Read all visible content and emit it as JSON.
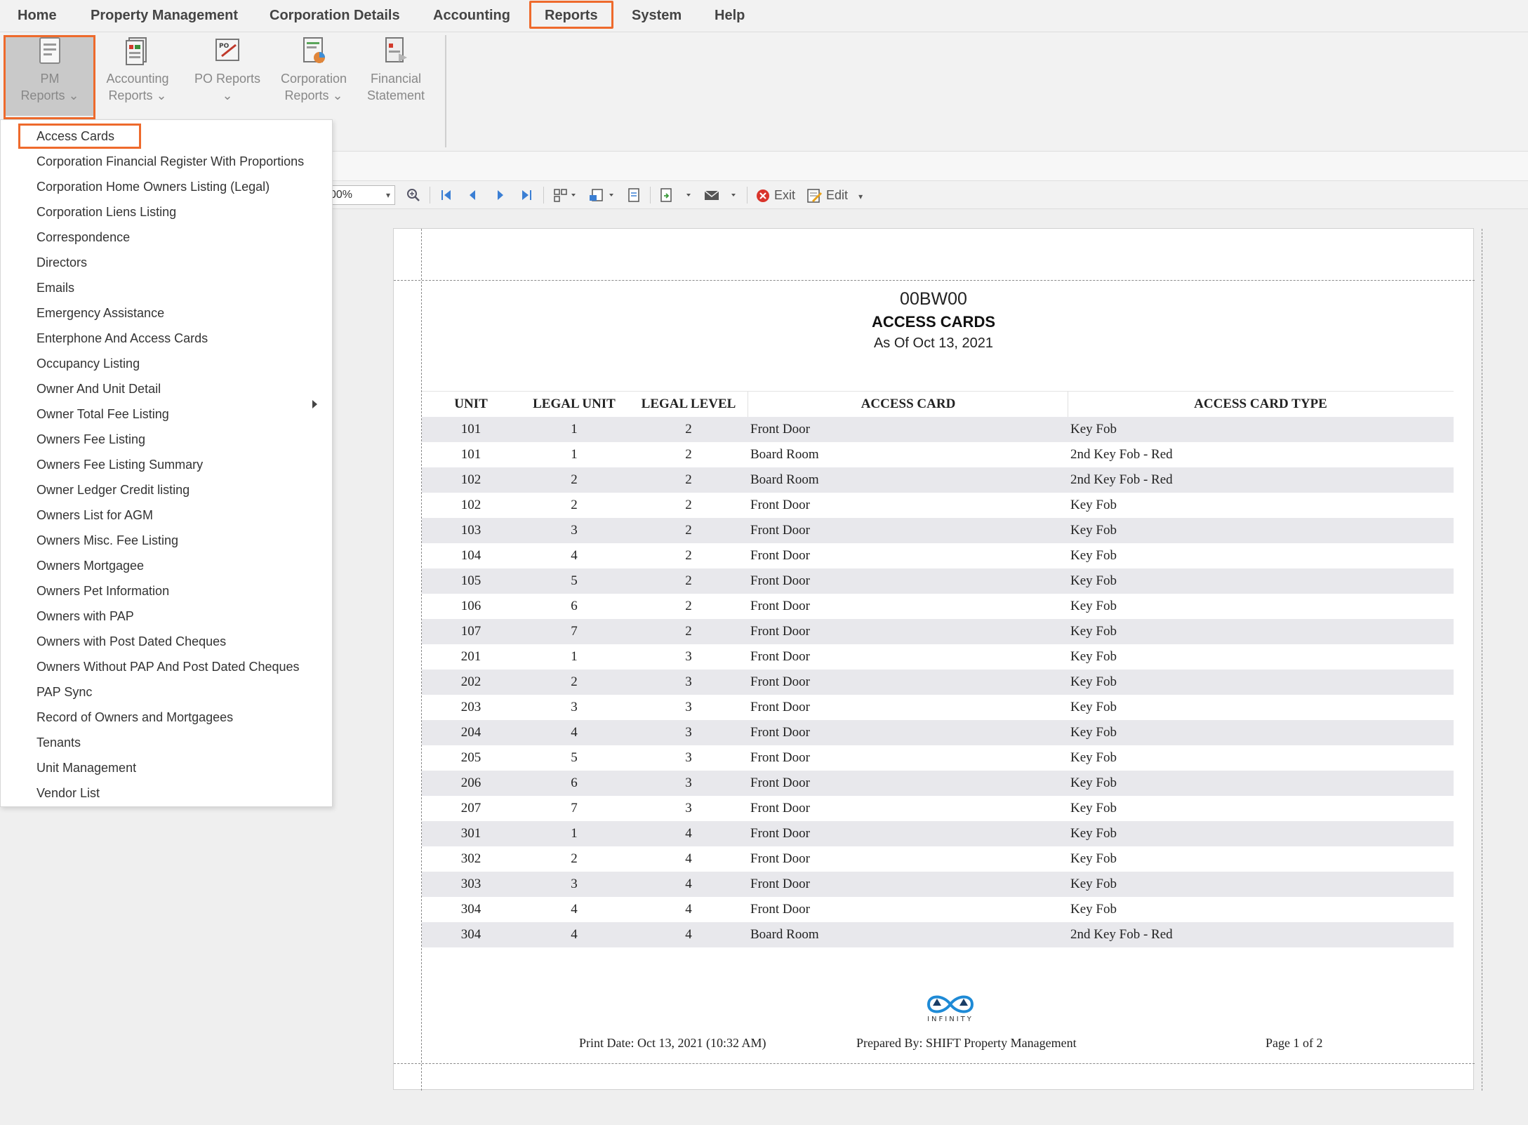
{
  "menubar": {
    "items": [
      "Home",
      "Property Management",
      "Corporation Details",
      "Accounting",
      "Reports",
      "System",
      "Help"
    ],
    "active": "Reports"
  },
  "ribbon": {
    "buttons": [
      {
        "line1": "PM",
        "line2": "Reports ⌄",
        "icon": "pm-reports-icon"
      },
      {
        "line1": "Accounting",
        "line2": "Reports ⌄",
        "icon": "accounting-reports-icon"
      },
      {
        "line1": "PO Reports",
        "line2": "⌄",
        "icon": "po-reports-icon"
      },
      {
        "line1": "Corporation",
        "line2": "Reports ⌄",
        "icon": "corporation-reports-icon"
      },
      {
        "line1": "Financial",
        "line2": "Statement",
        "icon": "financial-statement-icon"
      }
    ]
  },
  "toolbar": {
    "zoom": "00%",
    "exit_label": "Exit",
    "edit_label": "Edit"
  },
  "dropdown": {
    "items": [
      "Access Cards",
      "Corporation Financial Register With Proportions",
      "Corporation Home Owners Listing (Legal)",
      "Corporation Liens Listing",
      "Correspondence",
      "Directors",
      "Emails",
      "Emergency Assistance",
      "Enterphone And Access Cards",
      "Occupancy Listing",
      "Owner And Unit Detail",
      "Owner Total Fee Listing",
      "Owners Fee Listing",
      "Owners Fee Listing Summary",
      "Owner Ledger Credit listing",
      "Owners List for AGM",
      "Owners Misc. Fee Listing",
      "Owners Mortgagee",
      "Owners Pet Information",
      "Owners with PAP",
      "Owners with Post Dated Cheques",
      "Owners Without PAP And Post Dated Cheques",
      "PAP Sync",
      "Record of Owners and Mortgagees",
      "Tenants",
      "Unit Management",
      "Vendor List"
    ],
    "highlighted": "Access Cards",
    "submenu_item": "Emails"
  },
  "report": {
    "code": "00BW00",
    "title": "ACCESS CARDS",
    "as_of": "As Of Oct 13, 2021",
    "columns": [
      "UNIT",
      "LEGAL UNIT",
      "LEGAL LEVEL",
      "ACCESS CARD",
      "ACCESS CARD TYPE"
    ],
    "rows": [
      [
        "101",
        "1",
        "2",
        "Front Door",
        "Key Fob"
      ],
      [
        "101",
        "1",
        "2",
        "Board Room",
        "2nd Key Fob - Red"
      ],
      [
        "102",
        "2",
        "2",
        "Board Room",
        "2nd Key Fob - Red"
      ],
      [
        "102",
        "2",
        "2",
        "Front Door",
        "Key Fob"
      ],
      [
        "103",
        "3",
        "2",
        "Front Door",
        "Key Fob"
      ],
      [
        "104",
        "4",
        "2",
        "Front Door",
        "Key Fob"
      ],
      [
        "105",
        "5",
        "2",
        "Front Door",
        "Key Fob"
      ],
      [
        "106",
        "6",
        "2",
        "Front Door",
        "Key Fob"
      ],
      [
        "107",
        "7",
        "2",
        "Front Door",
        "Key Fob"
      ],
      [
        "201",
        "1",
        "3",
        "Front Door",
        "Key Fob"
      ],
      [
        "202",
        "2",
        "3",
        "Front Door",
        "Key Fob"
      ],
      [
        "203",
        "3",
        "3",
        "Front Door",
        "Key Fob"
      ],
      [
        "204",
        "4",
        "3",
        "Front Door",
        "Key Fob"
      ],
      [
        "205",
        "5",
        "3",
        "Front Door",
        "Key Fob"
      ],
      [
        "206",
        "6",
        "3",
        "Front Door",
        "Key Fob"
      ],
      [
        "207",
        "7",
        "3",
        "Front Door",
        "Key Fob"
      ],
      [
        "301",
        "1",
        "4",
        "Front Door",
        "Key Fob"
      ],
      [
        "302",
        "2",
        "4",
        "Front Door",
        "Key Fob"
      ],
      [
        "303",
        "3",
        "4",
        "Front Door",
        "Key Fob"
      ],
      [
        "304",
        "4",
        "4",
        "Front Door",
        "Key Fob"
      ],
      [
        "304",
        "4",
        "4",
        "Board Room",
        "2nd Key Fob - Red"
      ]
    ],
    "logo_text": "INFINITY",
    "footer": {
      "print_date": "Print Date:  Oct 13, 2021 (10:32 AM)",
      "prepared_by": "Prepared By: SHIFT Property Management",
      "page": "Page 1 of 2"
    }
  },
  "colors": {
    "highlight": "#ee6a2c",
    "alt_row": "#e8e8ec",
    "logo_blue": "#1e8ad6"
  }
}
